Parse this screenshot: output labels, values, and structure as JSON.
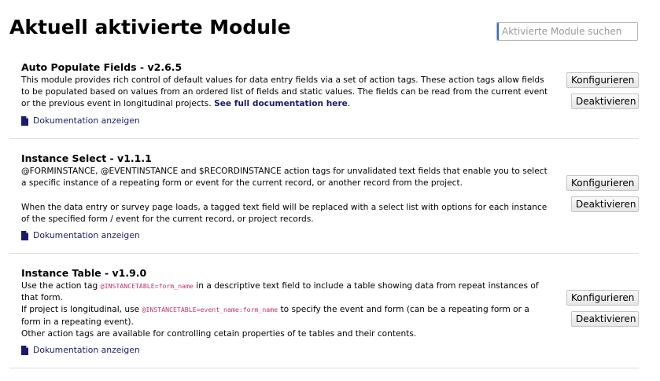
{
  "page": {
    "title": "Aktuell aktivierte Module",
    "search_placeholder": "Aktivierte Module suchen"
  },
  "buttons": {
    "configure_label": "Konfigurieren",
    "deactivate_label": "Deaktivieren"
  },
  "doc_link_label": "Dokumentation anzeigen",
  "modules": [
    {
      "title": "Auto Populate Fields - v2.6.5",
      "desc": "This module provides rich control of default values for data entry fields via a set of action tags. These action tags allow fields to be populated based on values from an ordered list of fields and static values. The fields can be read from the current event or the previous event in longitudinal projects.",
      "link": "See full documentation here",
      "link_suffix": "."
    },
    {
      "title": "Instance Select - v1.1.1",
      "para1": "@FORMINSTANCE, @EVENTINSTANCE and $RECORDINSTANCE action tags for unvalidated text fields that enable you to select a specific instance of a repeating form or event for the current record, or another record from the project.",
      "para2": "When the data entry or survey page loads, a tagged text field will be replaced with a select list with options for each instance of the specified form / event for the current record, or project records."
    },
    {
      "title": "Instance Table - v1.9.0",
      "l1_pre": "Use the action tag ",
      "l1_code": "@INSTANCETABLE=form_name",
      "l1_post": " in a descriptive text field to include a table showing data from repeat instances of that form.",
      "l2_pre": "If project is longitudinal, use ",
      "l2_code": "@INSTANCETABLE=event_name:form_name",
      "l2_post": " to specify the event and form (can be a repeating form or a form in a repeating event).",
      "l3": "Other action tags are available for controlling cetain properties of te tables and their contents."
    }
  ]
}
